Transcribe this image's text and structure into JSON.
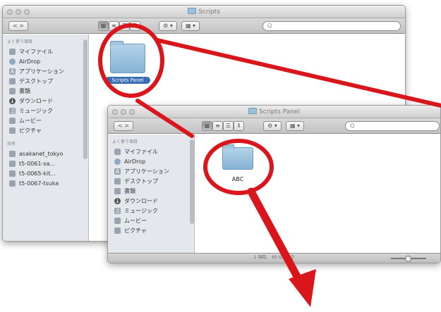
{
  "back_window": {
    "title": "Scripts",
    "search_placeholder": "Q",
    "toolbar_buttons": [
      "< >",
      "▦",
      "≡",
      "☰",
      "⫴",
      "⚙ ▾",
      "▦ ▾"
    ],
    "sidebar_heading": "よく使う項目",
    "sidebar_items": [
      {
        "label": "マイファイル",
        "icon": "files-icon"
      },
      {
        "label": "AirDrop",
        "icon": "airdrop-icon"
      },
      {
        "label": "アプリケーション",
        "icon": "applications-icon"
      },
      {
        "label": "デスクトップ",
        "icon": "desktop-icon"
      },
      {
        "label": "書類",
        "icon": "documents-icon"
      },
      {
        "label": "ダウンロード",
        "icon": "downloads-icon"
      },
      {
        "label": "ミュージック",
        "icon": "music-icon"
      },
      {
        "label": "ムービー",
        "icon": "movies-icon"
      },
      {
        "label": "ピクチャ",
        "icon": "pictures-icon"
      }
    ],
    "shared_heading": "共有",
    "shared_items": [
      "asakanet_tokyo",
      "t5-0061-sa...",
      "t5-0065-kit...",
      "t5-0067-tsuka"
    ],
    "folder_label": "Scripts Panel"
  },
  "front_window": {
    "title": "Scripts Panel",
    "search_placeholder": "Q",
    "toolbar_buttons": [
      "< >",
      "▦",
      "≡",
      "☰",
      "⫴",
      "⚙ ▾",
      "▦ ▾"
    ],
    "sidebar_heading": "よく使う項目",
    "sidebar_items": [
      {
        "label": "マイファイル",
        "icon": "files-icon"
      },
      {
        "label": "AirDrop",
        "icon": "airdrop-icon"
      },
      {
        "label": "アプリケーション",
        "icon": "applications-icon"
      },
      {
        "label": "デスクトップ",
        "icon": "desktop-icon"
      },
      {
        "label": "書類",
        "icon": "documents-icon"
      },
      {
        "label": "ダウンロード",
        "icon": "downloads-icon"
      },
      {
        "label": "ミュージック",
        "icon": "music-icon"
      },
      {
        "label": "ムービー",
        "icon": "movies-icon"
      },
      {
        "label": "ピクチャ",
        "icon": "pictures-icon"
      }
    ],
    "folder_label": "ABC",
    "status_text": "1 項目、 60 GB 空き"
  },
  "colors": {
    "annotation": "#d9161c",
    "folder": "#9ac0da",
    "sidebar": "#e4e8ed"
  }
}
